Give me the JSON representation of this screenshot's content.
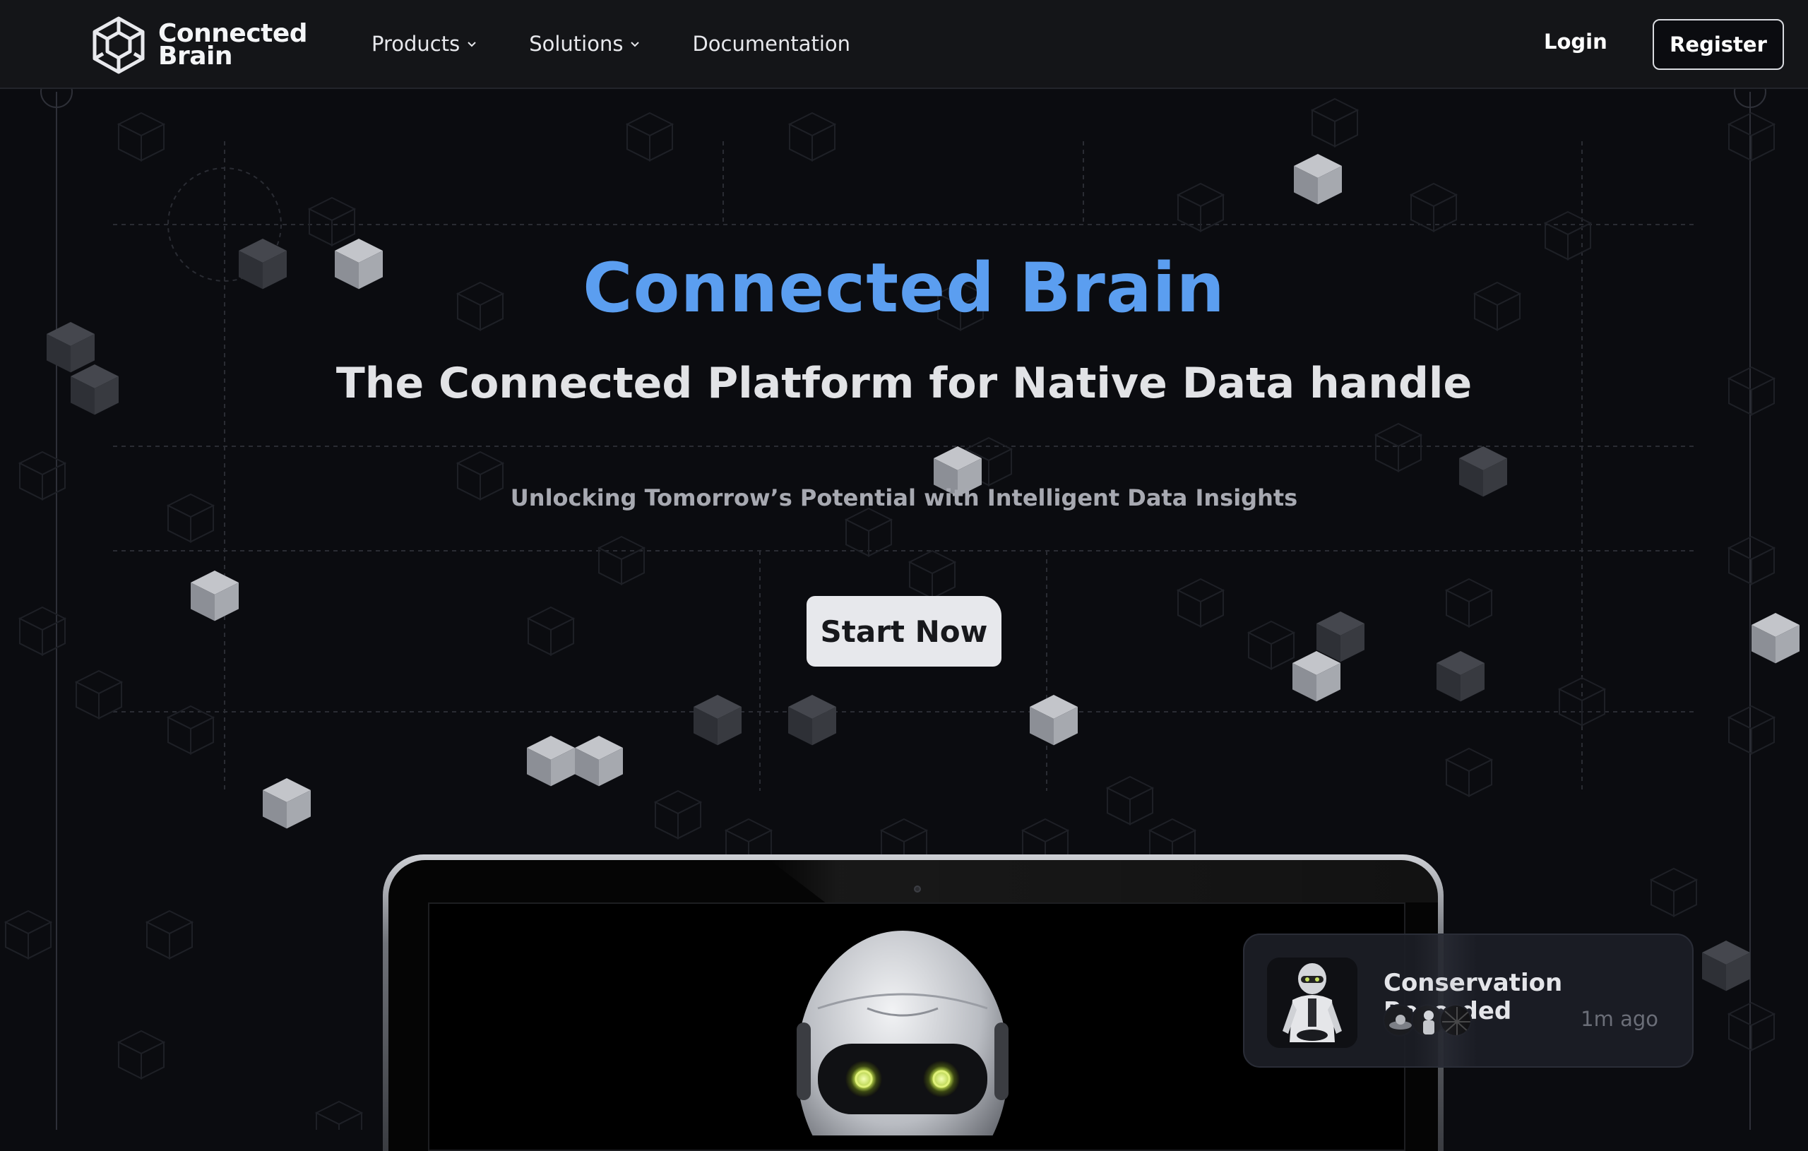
{
  "brand": {
    "name_line1": "Connected",
    "name_line2": "Brain",
    "logo_icon": "connected-brain-logo-icon"
  },
  "nav": {
    "items": [
      {
        "label": "Products",
        "has_dropdown": true
      },
      {
        "label": "Solutions",
        "has_dropdown": true
      },
      {
        "label": "Documentation",
        "has_dropdown": false
      }
    ],
    "login_label": "Login",
    "register_label": "Register"
  },
  "hero": {
    "title": "Connected Brain",
    "subtitle": "The Connected Platform for Native Data handle",
    "tagline": "Unlocking Tomorrow’s Potential with Intelligent Data Insights",
    "cta_label": "Start Now"
  },
  "notification": {
    "title": "Conservation Recorded",
    "time": "1m ago",
    "avatar_count": 3
  },
  "colors": {
    "background": "#0b0c10",
    "navbar": "#141518",
    "accent_title": "#5b9ef0",
    "cta_background": "#e7e8ec"
  }
}
